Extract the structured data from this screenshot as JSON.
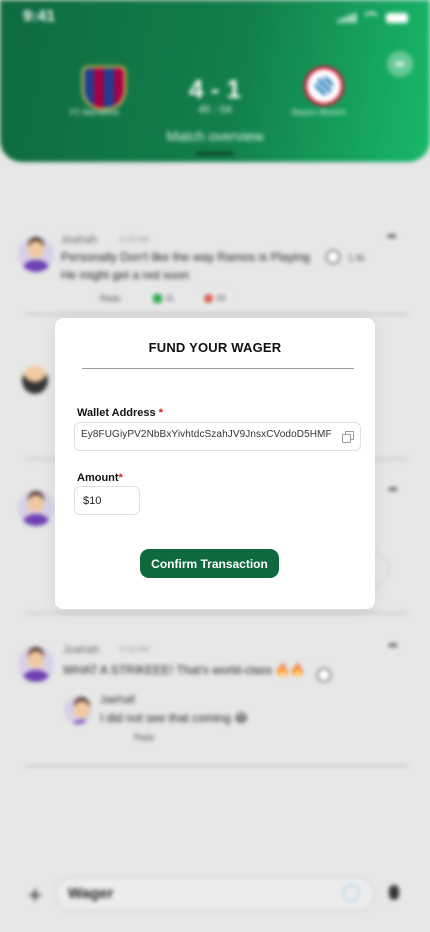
{
  "status_bar": {
    "time": "9:41"
  },
  "match": {
    "home_team": "FC Barcelona",
    "away_team": "Bayern Munich",
    "score": "4 - 1",
    "clock": "45 : 04",
    "tab_label": "Match overview"
  },
  "feed": {
    "comment1": {
      "author": "Joahah",
      "time": "9:16 AM",
      "line1": "Personally Don't like the way Ramos is Playing",
      "line2": "He might get a red soon",
      "reply": "Reply",
      "reaction1": "11",
      "reaction2": "20",
      "percent": "1.9k"
    },
    "comment2": {
      "author": "Joahah",
      "time": "9:16 AM",
      "text": "WHAT A STRIKEEE! That's world-class 🔥🔥"
    },
    "reply1": {
      "author": "Jaehall",
      "text": "I did not see that coming 😂",
      "reply": "Reply"
    }
  },
  "composer": {
    "value": "Wager"
  },
  "modal": {
    "title": "FUND YOUR WAGER",
    "wallet_label": "Wallet Address",
    "wallet_value": "Ey8FUGiyPV2NbBxYivhtdcSzahJV9JnsxCVodoD5HMF",
    "amount_label": "Amount",
    "amount_value": "$10",
    "confirm_label": "Confirm Transaction",
    "required_mark": "*"
  }
}
